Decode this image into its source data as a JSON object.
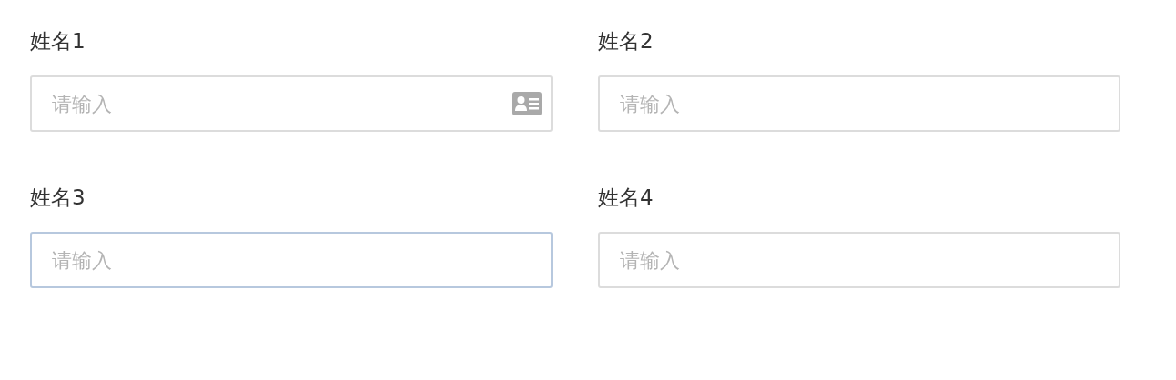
{
  "fields": [
    {
      "label": "姓名1",
      "placeholder": "请输入",
      "focused": false,
      "card_icon": true
    },
    {
      "label": "姓名2",
      "placeholder": "请输入",
      "focused": false,
      "card_icon": false
    },
    {
      "label": "姓名3",
      "placeholder": "请输入",
      "focused": true,
      "card_icon": false
    },
    {
      "label": "姓名4",
      "placeholder": "请输入",
      "focused": false,
      "card_icon": false
    }
  ]
}
